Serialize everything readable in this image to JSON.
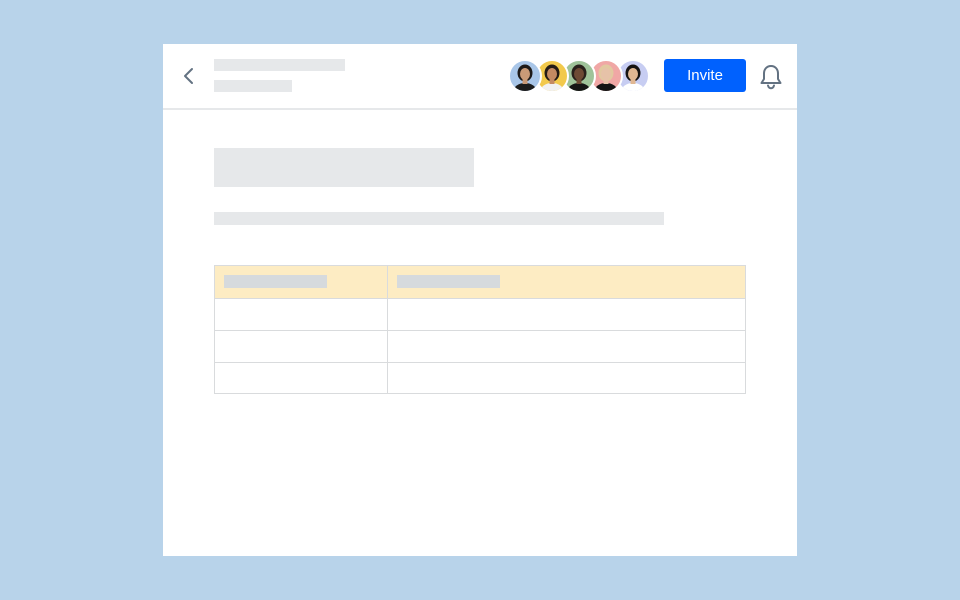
{
  "header": {
    "back_icon": "chevron-left-icon",
    "collaborators": [
      {
        "name": "collaborator-1",
        "bg": "#a9c6e8",
        "skin": "#c99a77",
        "hair": "#1e1a18",
        "shirt": "#1c1c1c"
      },
      {
        "name": "collaborator-2",
        "bg": "#f2c94c",
        "skin": "#c48a62",
        "hair": "#241b16",
        "shirt": "#f1f1f1"
      },
      {
        "name": "collaborator-3",
        "bg": "#9fc39a",
        "skin": "#6e4a35",
        "hair": "#2a211c",
        "shirt": "#151515"
      },
      {
        "name": "collaborator-4",
        "bg": "#f0a7a5",
        "skin": "#e6c2a8",
        "hair": "#e2c8a0",
        "shirt": "#141414"
      },
      {
        "name": "collaborator-5",
        "bg": "#c7cdf2",
        "skin": "#e0b792",
        "hair": "#161312",
        "shirt": "#ffffff"
      }
    ],
    "invite_label": "Invite",
    "bell_icon": "bell-icon"
  },
  "table": {
    "rows": 3,
    "header_color": "#fdecc3"
  },
  "colors": {
    "background": "#b8d3ea",
    "accent": "#0061fe",
    "placeholder": "#e6e8ea"
  }
}
